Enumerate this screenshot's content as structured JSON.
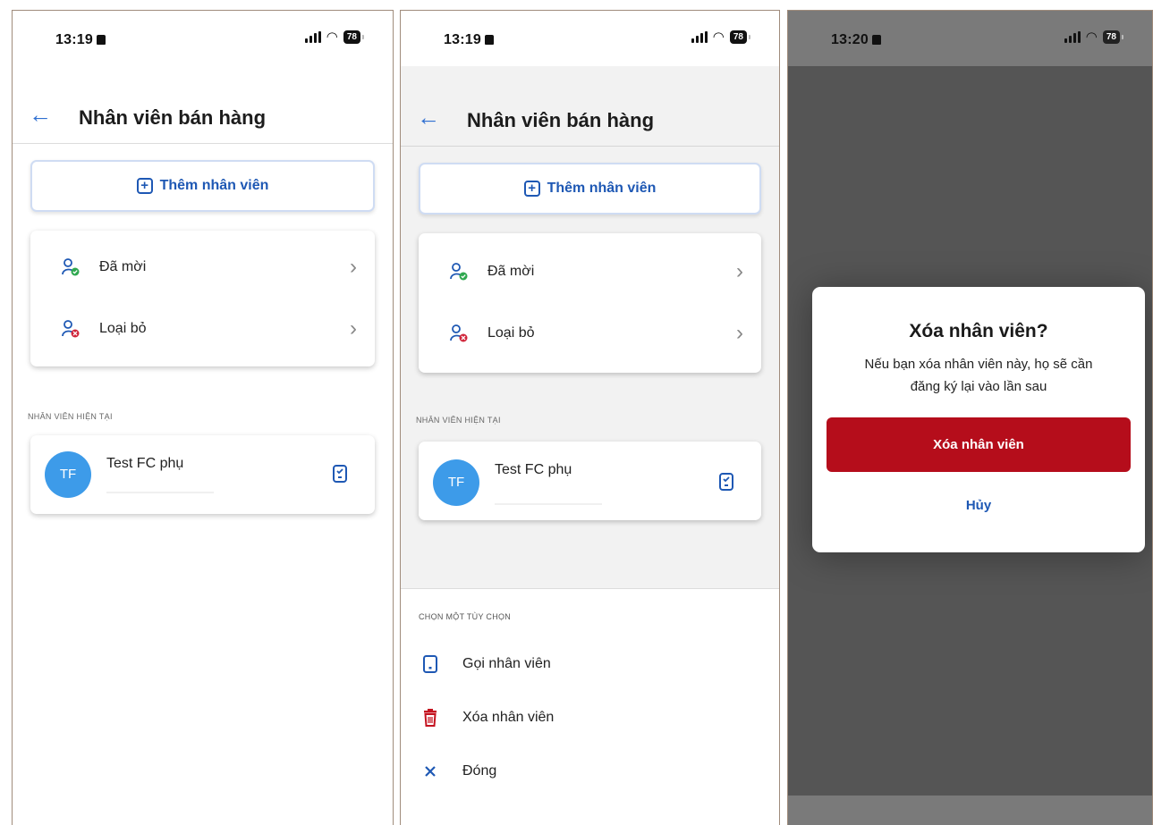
{
  "status": {
    "time_p1": "13:19",
    "time_p2": "13:19",
    "time_p3": "13:20",
    "battery": "78"
  },
  "header": {
    "title": "Nhân viên bán hàng"
  },
  "add_button": {
    "label": "Thêm nhân viên"
  },
  "menu": {
    "items": [
      {
        "label": "Đã mời",
        "icon": "user-check-icon"
      },
      {
        "label": "Loại bỏ",
        "icon": "user-remove-icon"
      }
    ]
  },
  "section": {
    "current_staff": "NHÂN VIÊN HIỆN TẠI"
  },
  "employee": {
    "initials": "TF",
    "name": "Test FC phụ"
  },
  "sheet": {
    "header": "CHỌN MỘT TÙY CHỌN",
    "options": [
      {
        "label": "Gọi nhân viên",
        "icon": "phone-icon"
      },
      {
        "label": "Xóa nhân viên",
        "icon": "trash-icon"
      },
      {
        "label": "Đóng",
        "icon": "close-icon"
      }
    ]
  },
  "dialog": {
    "title": "Xóa nhân viên?",
    "message_line1": "Nếu bạn xóa nhân viên này, họ sẽ cần",
    "message_line2": "đăng ký lại vào lần sau",
    "confirm": "Xóa nhân viên",
    "cancel": "Hủy"
  },
  "colors": {
    "accent": "#1e58b4",
    "danger": "#b50d1b",
    "avatar": "#3d9be9",
    "success": "#2fa84f"
  }
}
